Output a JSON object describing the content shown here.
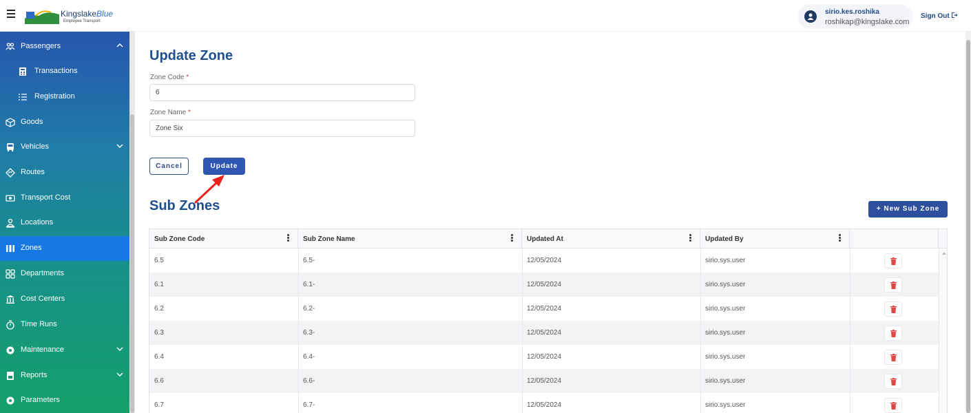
{
  "header": {
    "logo_text_main": "Kingslake",
    "logo_text_accent": "Blue",
    "logo_sub": "Employee Transport",
    "user_name": "sirio.kes.roshika",
    "user_email": "roshikap@kingslake.com",
    "signout_label": "Sign Out"
  },
  "sidebar": {
    "items": [
      {
        "label": "Passengers",
        "icon": "passengers-icon",
        "chevron": "up"
      },
      {
        "label": "Transactions",
        "icon": "calculator-icon"
      },
      {
        "label": "Registration",
        "icon": "list-icon"
      },
      {
        "label": "Goods",
        "icon": "box-icon"
      },
      {
        "label": "Vehicles",
        "icon": "bus-icon",
        "chevron": "down"
      },
      {
        "label": "Routes",
        "icon": "route-icon"
      },
      {
        "label": "Transport Cost",
        "icon": "money-icon"
      },
      {
        "label": "Locations",
        "icon": "person-pin-icon"
      },
      {
        "label": "Zones",
        "icon": "zones-icon",
        "active": true
      },
      {
        "label": "Departments",
        "icon": "grid-icon"
      },
      {
        "label": "Cost Centers",
        "icon": "bank-icon"
      },
      {
        "label": "Time Runs",
        "icon": "timer-icon"
      },
      {
        "label": "Maintenance",
        "icon": "gear-icon",
        "chevron": "down"
      },
      {
        "label": "Reports",
        "icon": "report-icon",
        "chevron": "down"
      },
      {
        "label": "Parameters",
        "icon": "settings-icon"
      }
    ]
  },
  "form": {
    "title": "Update Zone",
    "zone_code_label": "Zone Code",
    "zone_code_value": "6",
    "zone_name_label": "Zone Name",
    "zone_name_value": "Zone Six",
    "required_mark": "*",
    "cancel_label": "Cancel",
    "update_label": "Update"
  },
  "subzones": {
    "title": "Sub Zones",
    "new_button_label": "New Sub Zone",
    "columns": [
      "Sub Zone Code",
      "Sub Zone Name",
      "Updated At",
      "Updated By"
    ],
    "rows": [
      [
        "6.5",
        "6.5-",
        "12/05/2024",
        "sirio.sys.user"
      ],
      [
        "6.1",
        "6.1-",
        "12/05/2024",
        "sirio.sys.user"
      ],
      [
        "6.2",
        "6.2-",
        "12/05/2024",
        "sirio.sys.user"
      ],
      [
        "6.3",
        "6.3-",
        "12/05/2024",
        "sirio.sys.user"
      ],
      [
        "6.4",
        "6.4-",
        "12/05/2024",
        "sirio.sys.user"
      ],
      [
        "6.6",
        "6.6-",
        "12/05/2024",
        "sirio.sys.user"
      ],
      [
        "6.7",
        "6.7-",
        "12/05/2024",
        "sirio.sys.user"
      ]
    ]
  },
  "colors": {
    "primary": "#2f56b0",
    "title": "#1f4f8f",
    "active_nav": "#1777e3",
    "delete": "#e04848",
    "annotation_arrow": "#e8231d"
  }
}
